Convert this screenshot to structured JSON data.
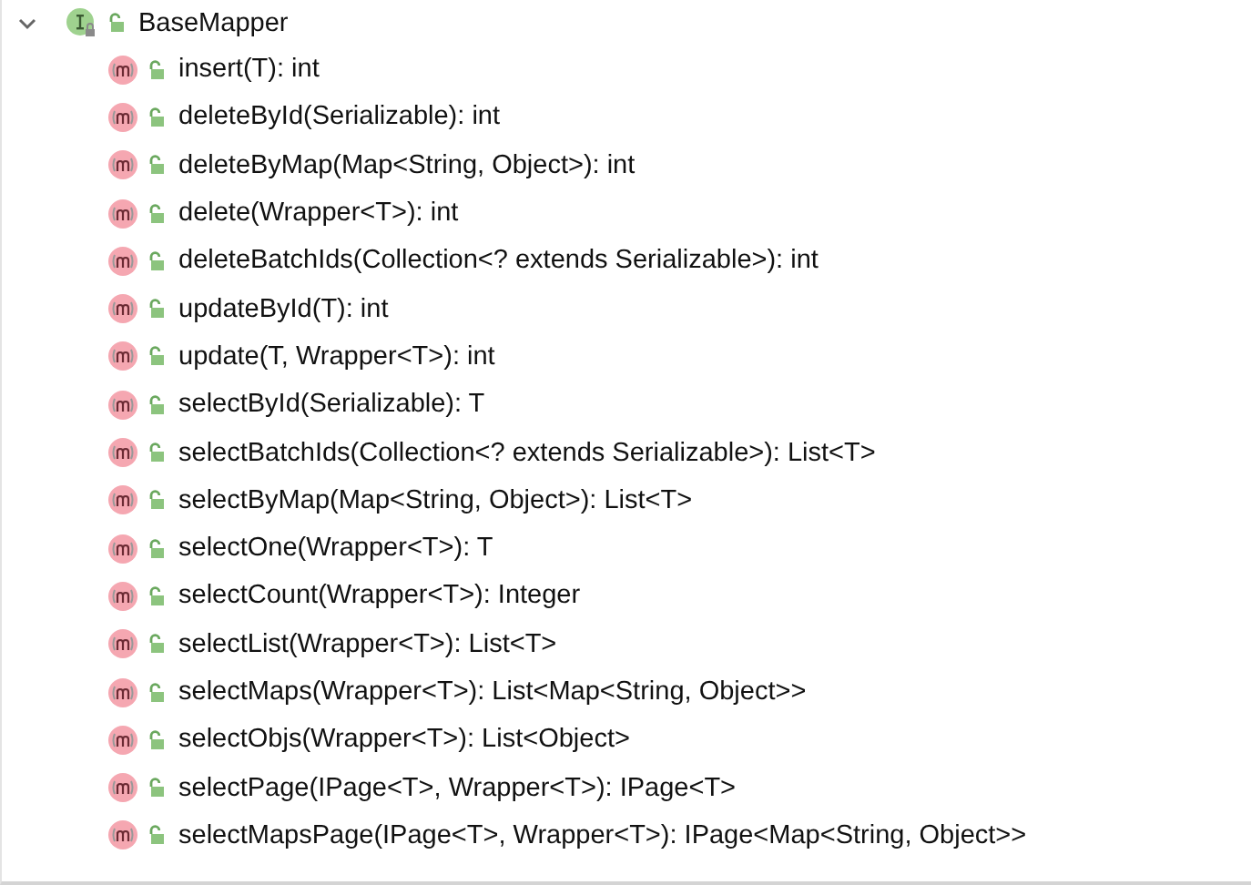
{
  "tree": {
    "kind": "interface",
    "label": "BaseMapper",
    "expanded": true,
    "children": [
      {
        "kind": "method",
        "label": "insert(T): int"
      },
      {
        "kind": "method",
        "label": "deleteById(Serializable): int"
      },
      {
        "kind": "method",
        "label": "deleteByMap(Map<String, Object>): int"
      },
      {
        "kind": "method",
        "label": "delete(Wrapper<T>): int"
      },
      {
        "kind": "method",
        "label": "deleteBatchIds(Collection<? extends Serializable>): int"
      },
      {
        "kind": "method",
        "label": "updateById(T): int"
      },
      {
        "kind": "method",
        "label": "update(T, Wrapper<T>): int"
      },
      {
        "kind": "method",
        "label": "selectById(Serializable): T"
      },
      {
        "kind": "method",
        "label": "selectBatchIds(Collection<? extends Serializable>): List<T>"
      },
      {
        "kind": "method",
        "label": "selectByMap(Map<String, Object>): List<T>"
      },
      {
        "kind": "method",
        "label": "selectOne(Wrapper<T>): T"
      },
      {
        "kind": "method",
        "label": "selectCount(Wrapper<T>): Integer"
      },
      {
        "kind": "method",
        "label": "selectList(Wrapper<T>): List<T>"
      },
      {
        "kind": "method",
        "label": "selectMaps(Wrapper<T>): List<Map<String, Object>>"
      },
      {
        "kind": "method",
        "label": "selectObjs(Wrapper<T>): List<Object>"
      },
      {
        "kind": "method",
        "label": "selectPage(IPage<T>, Wrapper<T>): IPage<T>"
      },
      {
        "kind": "method",
        "label": "selectMapsPage(IPage<T>, Wrapper<T>): IPage<Map<String, Object>>"
      }
    ]
  }
}
